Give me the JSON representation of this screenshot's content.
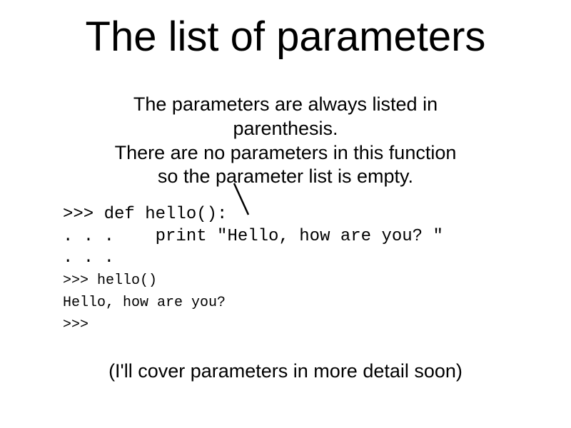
{
  "title": "The list of parameters",
  "subtitle_line1": "The parameters are always listed in",
  "subtitle_line2": "parenthesis.",
  "subtitle_line3": "There are no parameters in this function",
  "subtitle_line4": "so the parameter list is empty.",
  "code": {
    "line1": ">>> def hello():",
    "line2_prefix": ". . .",
    "line2_rest": "    print \"Hello, how are you? \"",
    "line3": ". . .",
    "line4": ">>> hello()",
    "line5": "Hello, how are you?",
    "line6": ">>>"
  },
  "footer": "(I'll cover parameters in more detail soon)"
}
